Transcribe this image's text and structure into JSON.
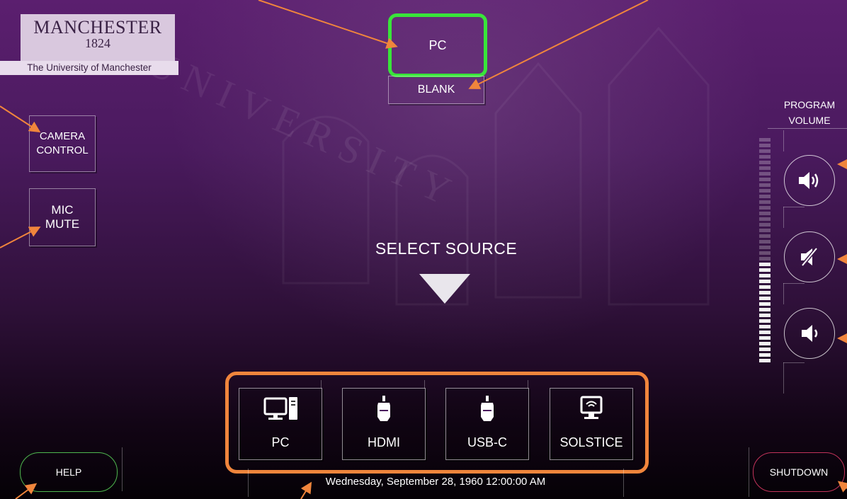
{
  "logo": {
    "name": "MANCHESTER",
    "year": "1824",
    "subtitle": "The University of Manchester"
  },
  "current_source": "PC",
  "blank_label": "BLANK",
  "camera_label_line1": "CAMERA",
  "camera_label_line2": "CONTROL",
  "mic_label_line1": "MIC",
  "mic_label_line2": "MUTE",
  "select_source_label": "SELECT SOURCE",
  "sources": [
    {
      "label": "PC",
      "icon": "computer-icon"
    },
    {
      "label": "HDMI",
      "icon": "hdmi-plug-icon"
    },
    {
      "label": "USB-C",
      "icon": "usb-c-plug-icon"
    },
    {
      "label": "SOLSTICE",
      "icon": "wireless-display-icon"
    }
  ],
  "help_label": "HELP",
  "shutdown_label": "SHUTDOWN",
  "datetime": "Wednesday, September 28, 1960 12:00:00 AM",
  "volume": {
    "label_line1": "PROGRAM",
    "label_line2": "VOLUME",
    "level_fraction": 0.45,
    "buttons": [
      "volume-up-icon",
      "volume-mute-icon",
      "volume-down-icon"
    ]
  },
  "colors": {
    "active_source_border": "#39e43a",
    "annotation": "#f0853c",
    "help_border": "#4fb84f",
    "shutdown_border": "#c2335a"
  }
}
